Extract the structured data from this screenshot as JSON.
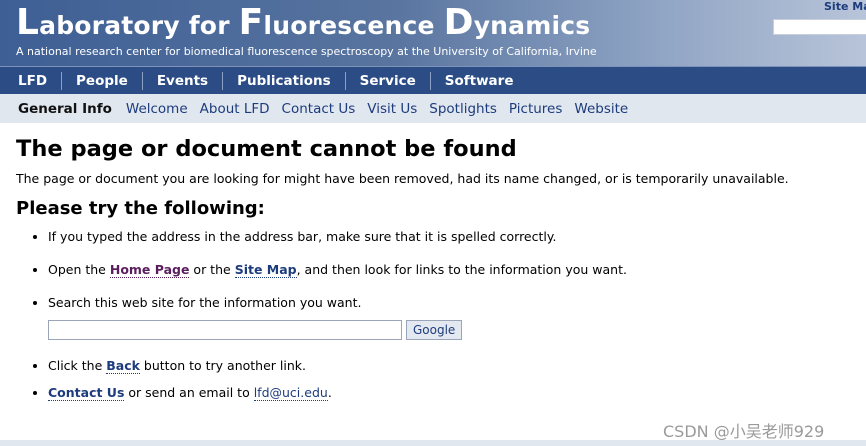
{
  "header": {
    "title_caps": [
      "L",
      "F",
      "D"
    ],
    "title_rest": [
      "aboratory for ",
      "luorescence ",
      "ynamics"
    ],
    "subtitle": "A national research center for biomedical fluorescence spectroscopy at the University of California, Irvine",
    "sitemap_link": "Site Ma",
    "search_value": ""
  },
  "mainnav": {
    "items": [
      "LFD",
      "People",
      "Events",
      "Publications",
      "Service",
      "Software"
    ]
  },
  "subnav": {
    "active": "General Info",
    "items": [
      "Welcome",
      "About LFD",
      "Contact Us",
      "Visit Us",
      "Spotlights",
      "Pictures",
      "Website"
    ]
  },
  "content": {
    "title": "The page or document cannot be found",
    "lead": "The page or document you are looking for might have been removed, had its name changed, or is temporarily unavailable.",
    "subtitle": "Please try the following:",
    "item1": "If you typed the address in the address bar, make sure that it is spelled correctly.",
    "item2_pre": "Open the ",
    "item2_link1": "Home Page",
    "item2_mid": " or the ",
    "item2_link2": "Site Map",
    "item2_post": ", and then look for links to the information you want.",
    "item3": "Search this web site for the information you want.",
    "search_value": "",
    "search_button": "Google",
    "item4_pre": "Click the ",
    "item4_link": "Back",
    "item4_post": " button to try another link.",
    "item5_link": "Contact Us",
    "item5_mid": " or send an email to ",
    "item5_email": "lfd@uci.edu",
    "item5_post": "."
  },
  "watermark": "CSDN @小吴老师929",
  "colors": {
    "nav_bg": "#2c4c86",
    "subnav_bg": "#e1e7ef",
    "link": "#1d3c7d",
    "visited_link": "#5a1d5e"
  }
}
